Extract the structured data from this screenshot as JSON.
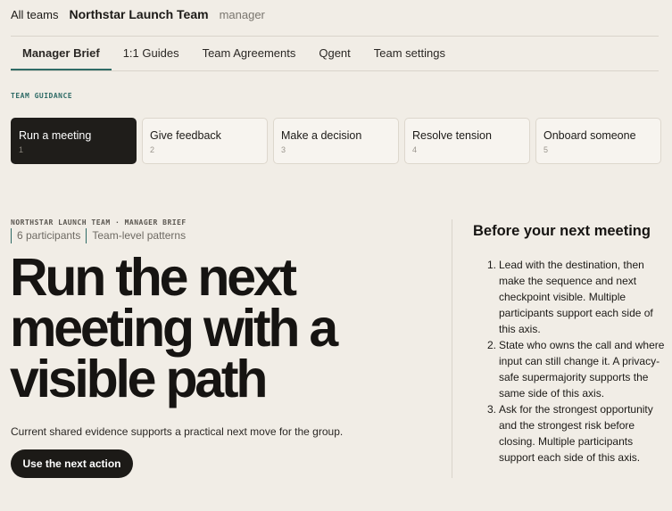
{
  "topbar": {
    "all_teams": "All teams",
    "team_name": "Northstar Launch Team",
    "role": "manager"
  },
  "tabs": [
    {
      "label": "Manager Brief",
      "active": true
    },
    {
      "label": "1:1 Guides"
    },
    {
      "label": "Team Agreements"
    },
    {
      "label": "Qgent"
    },
    {
      "label": "Team settings"
    }
  ],
  "guidance": {
    "label": "TEAM GUIDANCE",
    "cards": [
      {
        "title": "Run a meeting",
        "num": "1",
        "active": true
      },
      {
        "title": "Give feedback",
        "num": "2"
      },
      {
        "title": "Make a decision",
        "num": "3"
      },
      {
        "title": "Resolve tension",
        "num": "4"
      },
      {
        "title": "Onboard someone",
        "num": "5"
      }
    ]
  },
  "brief": {
    "eyebrow": "NORTHSTAR LAUNCH TEAM · MANAGER BRIEF",
    "participants": "6 participants",
    "scope": "Team-level patterns",
    "headline": "Run the next meeting with a visible path",
    "subtext": "Current shared evidence supports a practical next move for the group.",
    "cta": "Use the next action"
  },
  "side": {
    "title": "Before your next meeting",
    "steps": [
      {
        "num": "1.",
        "text": "Lead with the destination, then make the sequence and next checkpoint visible. Multiple participants support each side of this axis."
      },
      {
        "num": "2.",
        "text": "State who owns the call and where input can still change it. A privacy-safe supermajority supports the same side of this axis."
      },
      {
        "num": "3.",
        "text": "Ask for the strongest opportunity and the strongest risk before closing. Multiple participants support each side of this axis."
      }
    ]
  },
  "colors": {
    "background": "#f1ede6",
    "accent": "#2f6b66",
    "dark": "#1c1a17"
  }
}
